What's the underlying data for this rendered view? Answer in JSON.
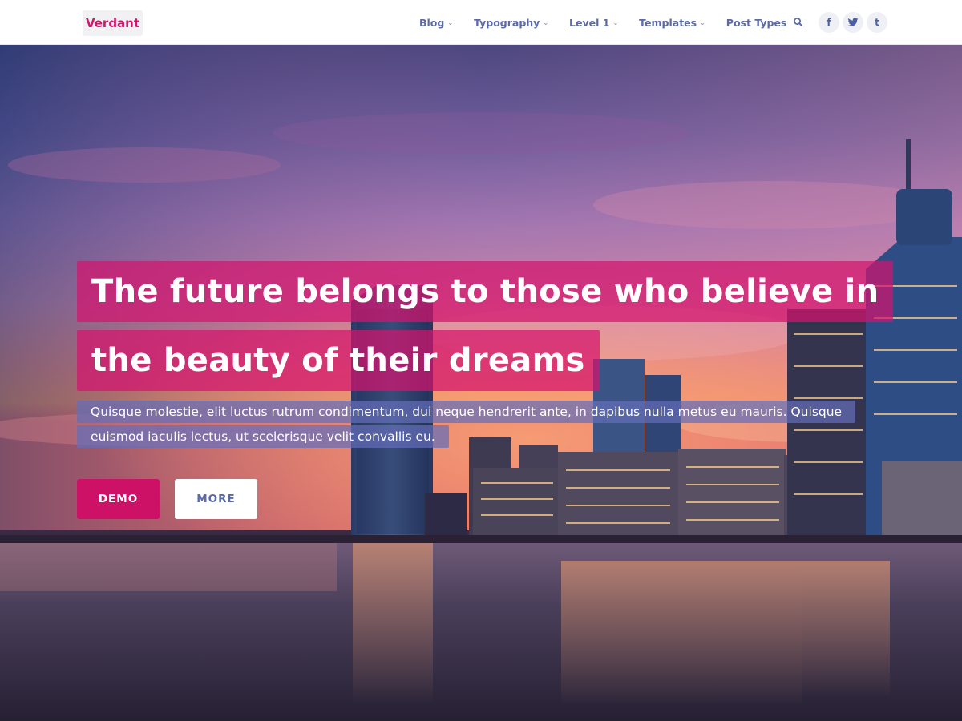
{
  "site": {
    "logo": "Verdant"
  },
  "nav": {
    "items": [
      {
        "label": "Blog",
        "has_submenu": true
      },
      {
        "label": "Typography",
        "has_submenu": true
      },
      {
        "label": "Level 1",
        "has_submenu": true
      },
      {
        "label": "Templates",
        "has_submenu": true
      },
      {
        "label": "Post Types",
        "has_submenu": false
      }
    ],
    "caret": "⌄",
    "search_icon": "search-icon",
    "social": [
      {
        "name": "facebook-icon",
        "glyph": "f"
      },
      {
        "name": "twitter-icon",
        "glyph": ""
      },
      {
        "name": "tumblr-icon",
        "glyph": "t"
      }
    ]
  },
  "hero": {
    "headline_line_1": "The future belongs to those who believe in",
    "headline_line_2": "the beauty of their dreams",
    "body_line_1": "Quisque molestie, elit luctus rutrum condimentum, dui neque hendrerit ante, in dapibus nulla metus eu mauris. Quisque",
    "body_line_2": "euismod iaculis lectus, ut scelerisque velit convallis eu.",
    "primary_button": "DEMO",
    "secondary_button": "MORE"
  },
  "colors": {
    "brand": "#d0176b",
    "nav_text": "#5a6aa8",
    "headline_bg": "#d4146e",
    "body_bg": "#646eb9",
    "demo_button": "#cc1166"
  }
}
